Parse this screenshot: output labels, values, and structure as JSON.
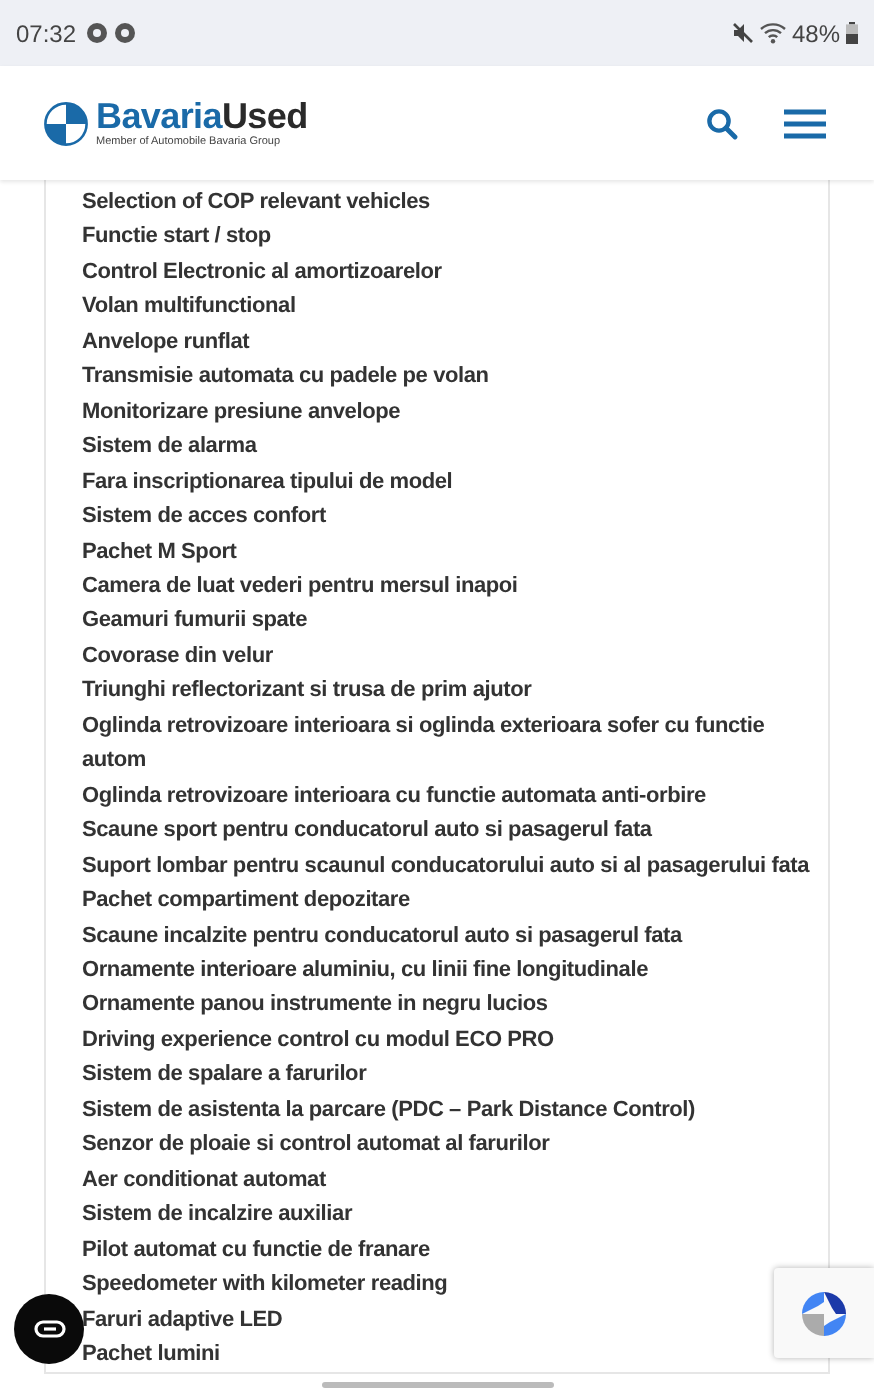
{
  "status_bar": {
    "time": "07:32",
    "battery": "48%"
  },
  "header": {
    "brand": "Bavaria",
    "brand_suffix": "Used",
    "tagline": "Member of Automobile Bavaria Group"
  },
  "features": [
    "Selection of COP relevant vehicles",
    "Functie start / stop",
    "Control Electronic al amortizoarelor",
    "Volan multifunctional",
    "Anvelope runflat",
    "Transmisie automata cu padele pe volan",
    "Monitorizare presiune anvelope",
    "Sistem de alarma",
    "Fara inscriptionarea tipului de model",
    "Sistem de acces confort",
    "Pachet M Sport",
    "Camera de luat vederi pentru mersul inapoi",
    "Geamuri fumurii spate",
    "Covorase din velur",
    "Triunghi reflectorizant si trusa de prim ajutor",
    "Oglinda retrovizoare interioara si oglinda exterioara sofer cu functie autom",
    "Oglinda retrovizoare interioara cu functie automata anti-orbire",
    "Scaune sport pentru conducatorul auto si pasagerul fata",
    "Suport lombar pentru scaunul conducatorului auto si al pasagerului fata",
    "Pachet compartiment depozitare",
    "Scaune incalzite pentru conducatorul auto si pasagerul fata",
    "Ornamente interioare aluminiu, cu linii fine longitudinale",
    "Ornamente panou instrumente in negru lucios",
    "Driving experience control cu modul ECO PRO",
    "Sistem de spalare a farurilor",
    "Sistem de asistenta la parcare (PDC – Park Distance Control)",
    "Senzor de ploaie si control automat al farurilor",
    "Aer conditionat automat",
    "Sistem de incalzire auxiliar",
    "Pilot automat cu functie de franare",
    "Speedometer with kilometer reading",
    "Faruri adaptive LED",
    "Pachet lumini"
  ]
}
